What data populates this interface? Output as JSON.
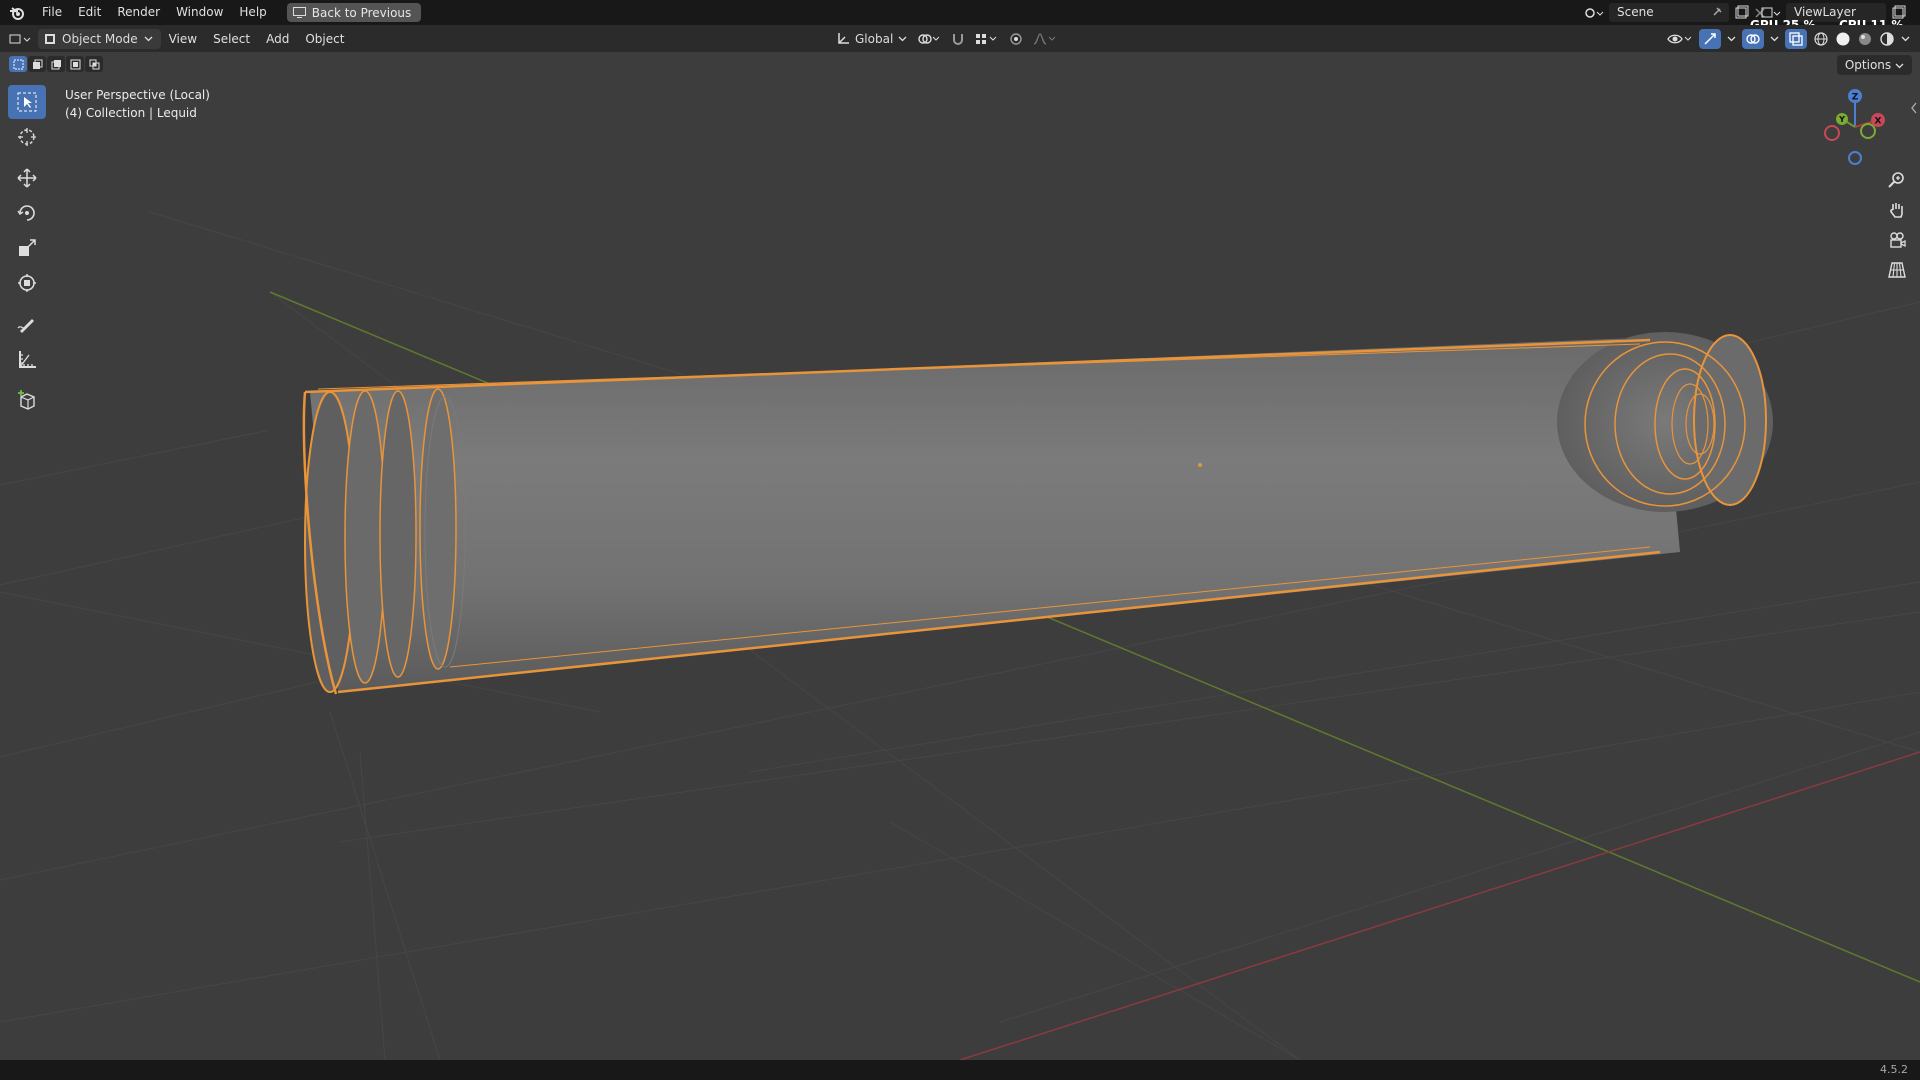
{
  "menu": {
    "items": [
      "File",
      "Edit",
      "Render",
      "Window",
      "Help"
    ],
    "back_label": "Back to Previous"
  },
  "scene": {
    "name": "Scene"
  },
  "view_layer": {
    "name": "ViewLayer"
  },
  "perf": {
    "gpu": "GPU 25 %",
    "cpu": "CPU 11 %"
  },
  "header": {
    "mode": "Object Mode",
    "items": [
      "View",
      "Select",
      "Add",
      "Object"
    ],
    "transform_orientation": "Global"
  },
  "viewport": {
    "perspective": "User Perspective (Local)",
    "collection": "(4) Collection | Lequid",
    "options_label": "Options"
  },
  "gizmo": {
    "x": "X",
    "y": "Y",
    "z": "Z"
  },
  "status": {
    "version": "4.5.2"
  },
  "colors": {
    "selection_outline": "#e8943a",
    "active_blue": "#4772b3",
    "axis_x": "#b03a45",
    "axis_y": "#6a9a2a"
  }
}
